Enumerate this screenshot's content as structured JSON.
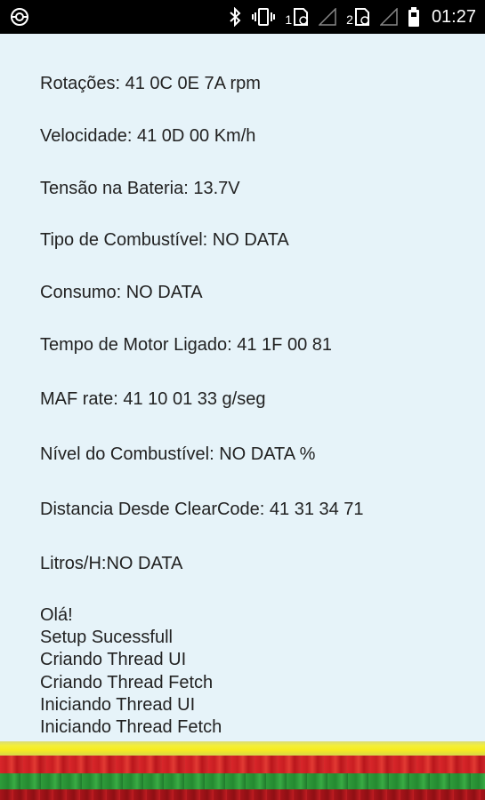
{
  "status_bar": {
    "sim1_label": "1",
    "sim2_label": "2",
    "time": "01:27"
  },
  "readings": [
    {
      "text": "Rotações:  41 0C 0E 7A rpm"
    },
    {
      "text": "Velocidade:  41 0D 00 Km/h"
    },
    {
      "text": "Tensão na Bateria:  13.7V"
    },
    {
      "text": "Tipo de Combustível:  NO DATA"
    },
    {
      "text": "Consumo:  NO DATA"
    },
    {
      "text": "Tempo de Motor Ligado:  41 1F 00 81"
    },
    {
      "text": "MAF rate:  41 10 01 33 g/seg"
    },
    {
      "text": "Nível do Combustível:  NO DATA %"
    },
    {
      "text": "Distancia Desde ClearCode: 41 31 34 71"
    },
    {
      "text": "Litros/H:NO DATA"
    }
  ],
  "log": [
    "Olá!",
    "Setup Sucessfull",
    "Criando Thread UI",
    "Criando Thread Fetch",
    "Iniciando Thread UI",
    "Iniciando Thread Fetch"
  ],
  "colors": {
    "background": "#e6f3f9",
    "status_bar": "#000000",
    "bar_yellow": "#f6ec1f",
    "bar_red": "#d8262a",
    "bar_green": "#2f9b3a",
    "bar_dark_red": "#a8141a"
  },
  "icons": {
    "left": "app-notification-icon",
    "right": [
      "bluetooth-icon",
      "vibrate-icon",
      "sim1-icon",
      "signal-icon",
      "sim2-icon",
      "signal-icon",
      "battery-icon"
    ]
  }
}
